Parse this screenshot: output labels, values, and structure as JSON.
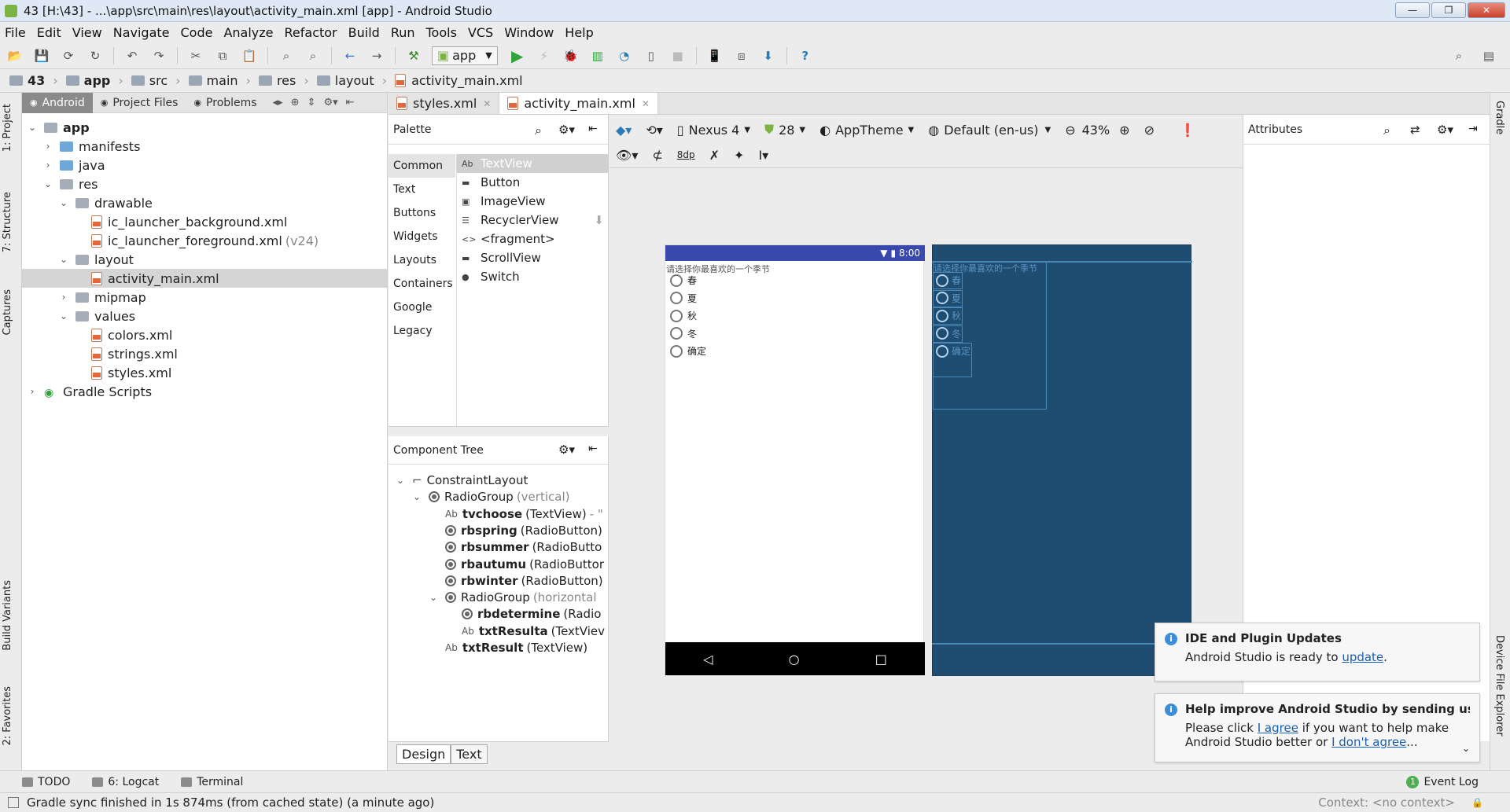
{
  "window": {
    "title": "43 [H:\\43] - ...\\app\\src\\main\\res\\layout\\activity_main.xml [app] - Android Studio"
  },
  "menu": [
    "File",
    "Edit",
    "View",
    "Navigate",
    "Code",
    "Analyze",
    "Refactor",
    "Build",
    "Run",
    "Tools",
    "VCS",
    "Window",
    "Help"
  ],
  "toolbar": {
    "run_config": "app"
  },
  "breadcrumb": [
    "43",
    "app",
    "src",
    "main",
    "res",
    "layout",
    "activity_main.xml"
  ],
  "left_strip": {
    "project": "1: Project",
    "structure": "7: Structure",
    "captures": "Captures",
    "build_variants": "Build Variants",
    "favorites": "2: Favorites"
  },
  "right_strip": {
    "gradle": "Gradle",
    "device_file_explorer": "Device File Explorer"
  },
  "project_panel": {
    "tabs": [
      "Android",
      "Project Files",
      "Problems"
    ],
    "tree": [
      {
        "label": "app",
        "level": 0,
        "toggle": "v",
        "icon": "folder",
        "bold": true
      },
      {
        "label": "manifests",
        "level": 1,
        "toggle": ">",
        "icon": "folder-blue"
      },
      {
        "label": "java",
        "level": 1,
        "toggle": ">",
        "icon": "folder-blue"
      },
      {
        "label": "res",
        "level": 1,
        "toggle": "v",
        "icon": "folder-gray"
      },
      {
        "label": "drawable",
        "level": 2,
        "toggle": "v",
        "icon": "folder-gray"
      },
      {
        "label": "ic_launcher_background.xml",
        "level": 3,
        "toggle": "",
        "icon": "xml"
      },
      {
        "label": "ic_launcher_foreground.xml",
        "suffix": "(v24)",
        "level": 3,
        "toggle": "",
        "icon": "xml"
      },
      {
        "label": "layout",
        "level": 2,
        "toggle": "v",
        "icon": "folder-gray"
      },
      {
        "label": "activity_main.xml",
        "level": 3,
        "toggle": "",
        "icon": "xml",
        "selected": true
      },
      {
        "label": "mipmap",
        "level": 2,
        "toggle": ">",
        "icon": "folder-gray"
      },
      {
        "label": "values",
        "level": 2,
        "toggle": "v",
        "icon": "folder-gray"
      },
      {
        "label": "colors.xml",
        "level": 3,
        "toggle": "",
        "icon": "xml"
      },
      {
        "label": "strings.xml",
        "level": 3,
        "toggle": "",
        "icon": "xml"
      },
      {
        "label": "styles.xml",
        "level": 3,
        "toggle": "",
        "icon": "xml"
      },
      {
        "label": "Gradle Scripts",
        "level": 0,
        "toggle": ">",
        "icon": "gradle"
      }
    ]
  },
  "editor_tabs": [
    {
      "label": "styles.xml",
      "active": false
    },
    {
      "label": "activity_main.xml",
      "active": true
    }
  ],
  "palette": {
    "title": "Palette",
    "categories": [
      "Common",
      "Text",
      "Buttons",
      "Widgets",
      "Layouts",
      "Containers",
      "Google",
      "Legacy"
    ],
    "items": [
      {
        "icon": "Ab",
        "label": "TextView",
        "active": true
      },
      {
        "icon": "▬",
        "label": "Button"
      },
      {
        "icon": "▣",
        "label": "ImageView"
      },
      {
        "icon": "☰",
        "label": "RecyclerView"
      },
      {
        "icon": "<>",
        "label": "<fragment>"
      },
      {
        "icon": "▬",
        "label": "ScrollView"
      },
      {
        "icon": "●",
        "label": "Switch"
      }
    ]
  },
  "component_tree": {
    "title": "Component Tree",
    "rows": [
      {
        "indent": 0,
        "toggle": "v",
        "icon": "constraint",
        "name": "ConstraintLayout",
        "type": ""
      },
      {
        "indent": 1,
        "toggle": "v",
        "icon": "radio",
        "name": "RadioGroup",
        "type": "(vertical)",
        "muted_type": true
      },
      {
        "indent": 2,
        "toggle": "",
        "icon": "ab",
        "name": "tvchoose",
        "type": "(TextView)",
        "extra": "- \"",
        "bold": true
      },
      {
        "indent": 2,
        "toggle": "",
        "icon": "radio",
        "name": "rbspring",
        "type": "(RadioButton)",
        "bold": true
      },
      {
        "indent": 2,
        "toggle": "",
        "icon": "radio",
        "name": "rbsummer",
        "type": "(RadioButto",
        "bold": true
      },
      {
        "indent": 2,
        "toggle": "",
        "icon": "radio",
        "name": "rbautumu",
        "type": "(RadioButtor",
        "bold": true
      },
      {
        "indent": 2,
        "toggle": "",
        "icon": "radio",
        "name": "rbwinter",
        "type": "(RadioButton)",
        "bold": true
      },
      {
        "indent": 2,
        "toggle": "v",
        "icon": "radio",
        "name": "RadioGroup",
        "type": "(horizontal",
        "muted_type": true
      },
      {
        "indent": 3,
        "toggle": "",
        "icon": "radio",
        "name": "rbdetermine",
        "type": "(Radio",
        "bold": true
      },
      {
        "indent": 3,
        "toggle": "",
        "icon": "ab",
        "name": "txtResulta",
        "type": "(TextViev",
        "bold": true
      },
      {
        "indent": 2,
        "toggle": "",
        "icon": "ab",
        "name": "txtResult",
        "type": "(TextView)",
        "bold": true
      }
    ]
  },
  "design_tabs": [
    "Design",
    "Text"
  ],
  "design_toolbar": {
    "device": "Nexus 4",
    "api": "28",
    "theme": "AppTheme",
    "locale": "Default (en-us)",
    "zoom": "43%",
    "margin": "8dp"
  },
  "attributes": {
    "title": "Attributes"
  },
  "phone": {
    "time": "8:00",
    "prompt": "请选择你最喜欢的一个季节",
    "options": [
      "春",
      "夏",
      "秋",
      "冬",
      "确定"
    ]
  },
  "notifications": [
    {
      "title": "IDE and Plugin Updates",
      "text": "Android Studio is ready to ",
      "link": "update",
      "after": "."
    },
    {
      "title": "Help improve Android Studio by sending usag",
      "line1": "Please click ",
      "link1": "I agree",
      "line1b": " if you want to help make",
      "line2": "Android Studio better or ",
      "link2": "I don't agree",
      "after2": "..."
    }
  ],
  "bottom_tools": [
    {
      "label": "TODO"
    },
    {
      "label": "6: Logcat"
    },
    {
      "label": "Terminal"
    }
  ],
  "event_log": {
    "count": "1",
    "label": "Event Log"
  },
  "status": {
    "message": "Gradle sync finished in 1s 874ms (from cached state) (a minute ago)",
    "context": "Context: <no context>"
  }
}
